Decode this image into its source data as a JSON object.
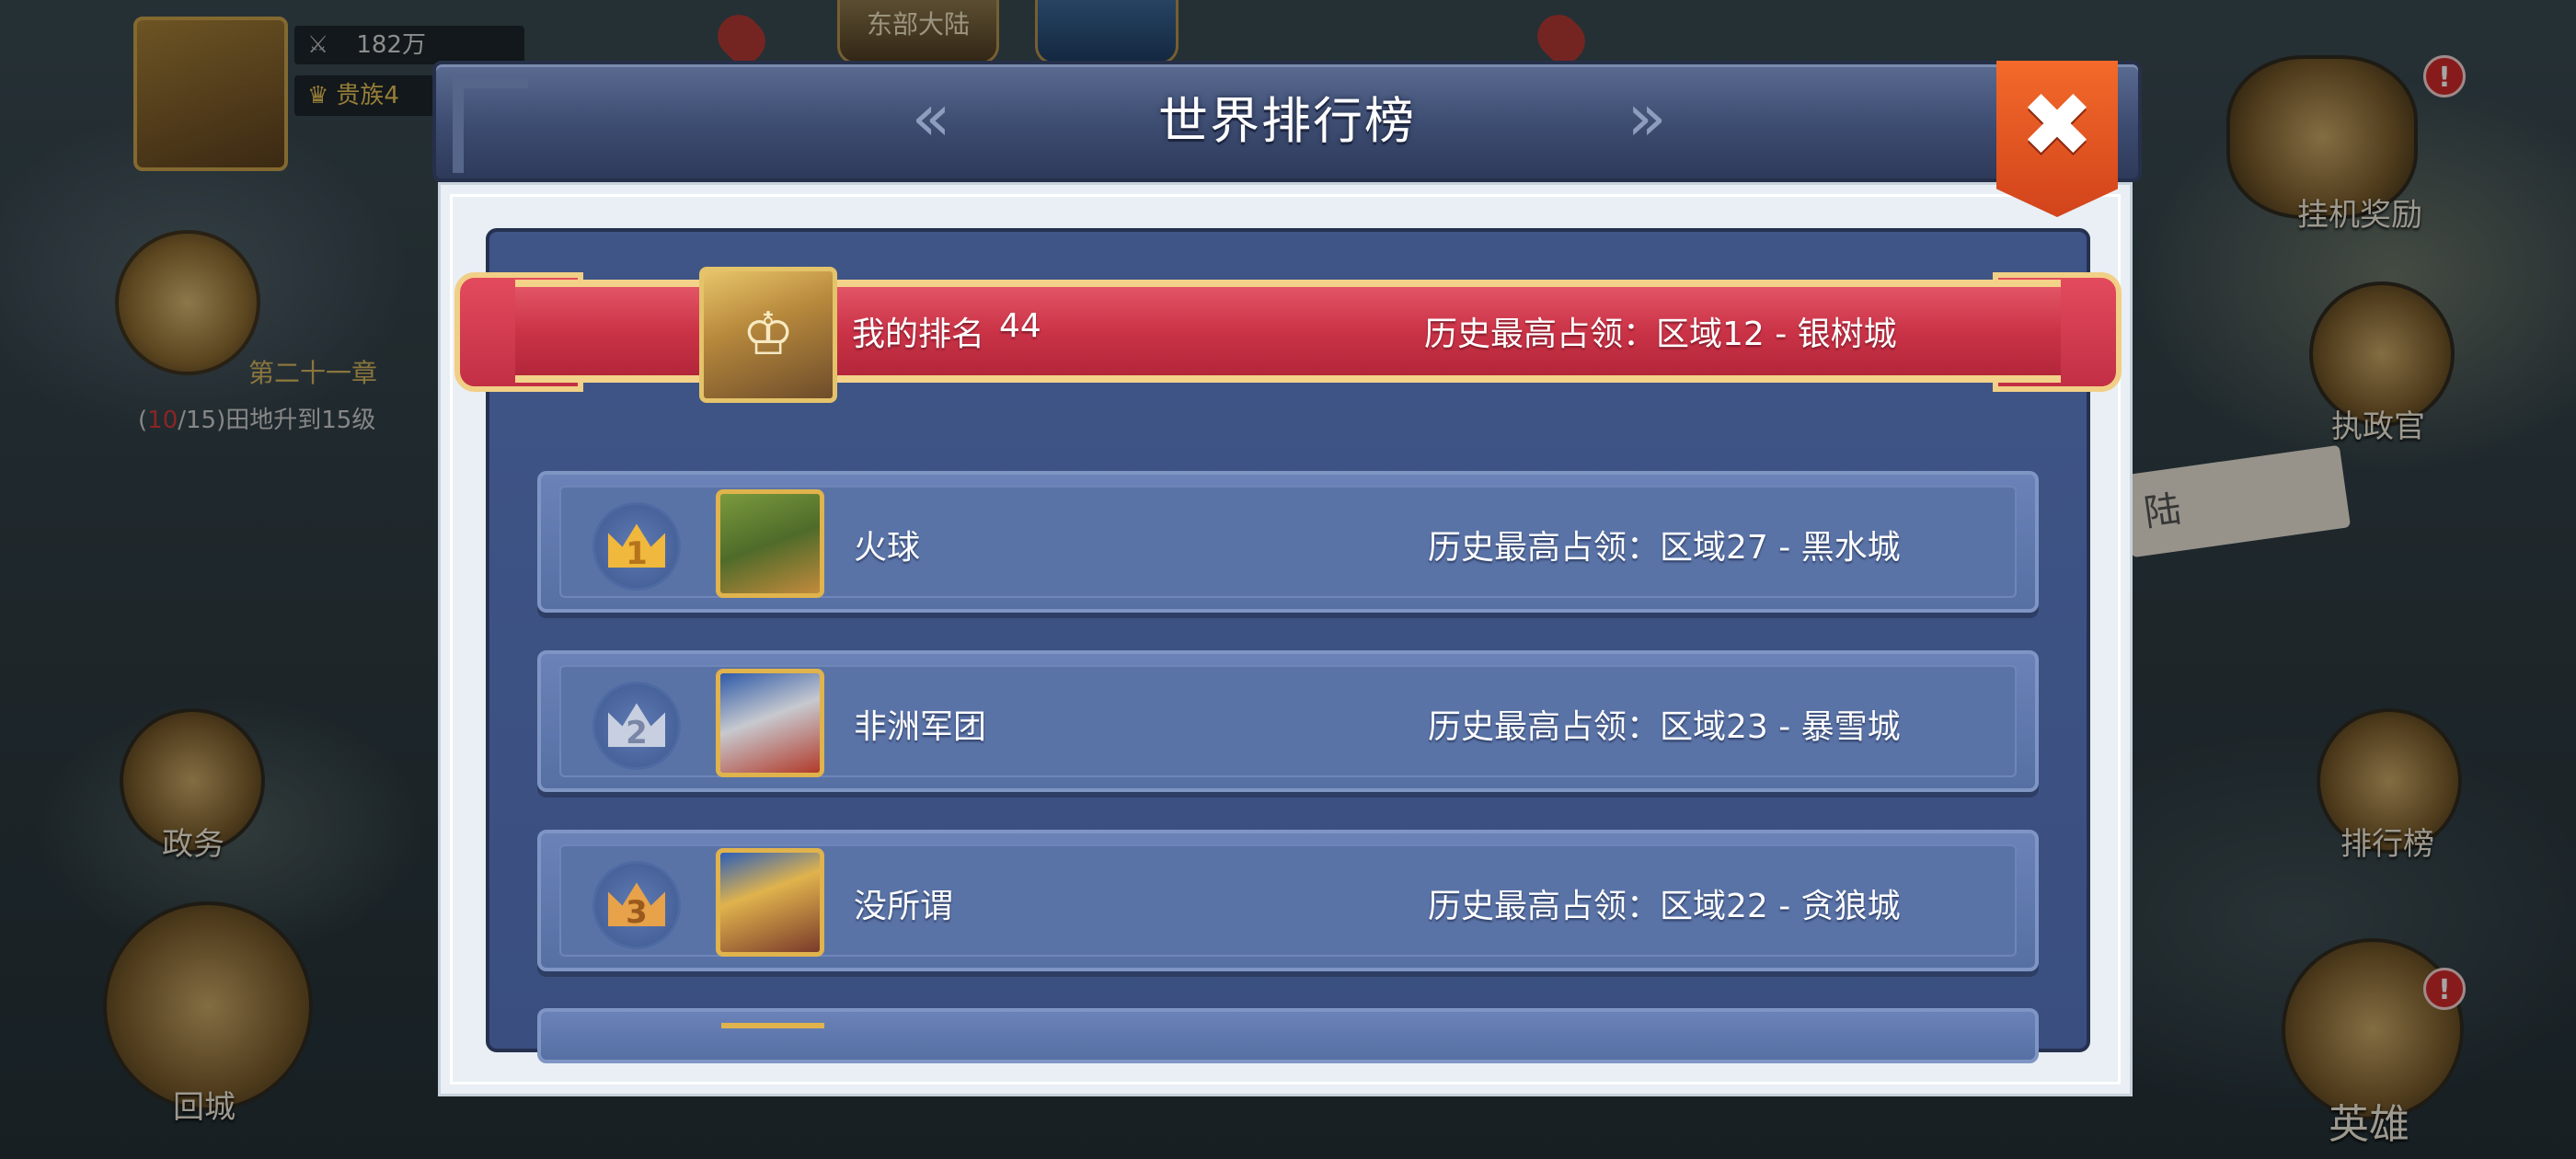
{
  "hud": {
    "power": "182万",
    "noble": "贵族4",
    "continent": "东部大陆",
    "chapter": "第二十一章",
    "task_progress_current": "10",
    "task_progress_rest": "/15)田地升到15级",
    "task_open_paren": "(",
    "sign_text": "陆",
    "buttons": {
      "affairs": "政务",
      "return_city": "回城",
      "idle_reward": "挂机奖励",
      "governor": "执政官",
      "leaderboard": "排行榜",
      "hero": "英雄"
    },
    "badge": "!"
  },
  "modal": {
    "title": "世界排行榜",
    "prev_icon": "double-chevron-left-icon",
    "next_icon": "double-chevron-right-icon",
    "close_icon": "close-x-icon",
    "close_color": "#e0521f",
    "accent_ribbon": "#cb3347",
    "my_rank": {
      "label": "我的排名",
      "value": "44",
      "history": "历史最高占领：区域12 - 银树城"
    },
    "rows": [
      {
        "rank": "1",
        "name": "火球",
        "history": "历史最高占领：区域27 - 黑水城",
        "crown_color": "#f0b83c"
      },
      {
        "rank": "2",
        "name": "非洲军团",
        "history": "历史最高占领：区域23 - 暴雪城",
        "crown_color": "#c7cfe0"
      },
      {
        "rank": "3",
        "name": "没所谓",
        "history": "历史最高占领：区域22 - 贪狼城",
        "crown_color": "#e7a24a"
      }
    ]
  }
}
